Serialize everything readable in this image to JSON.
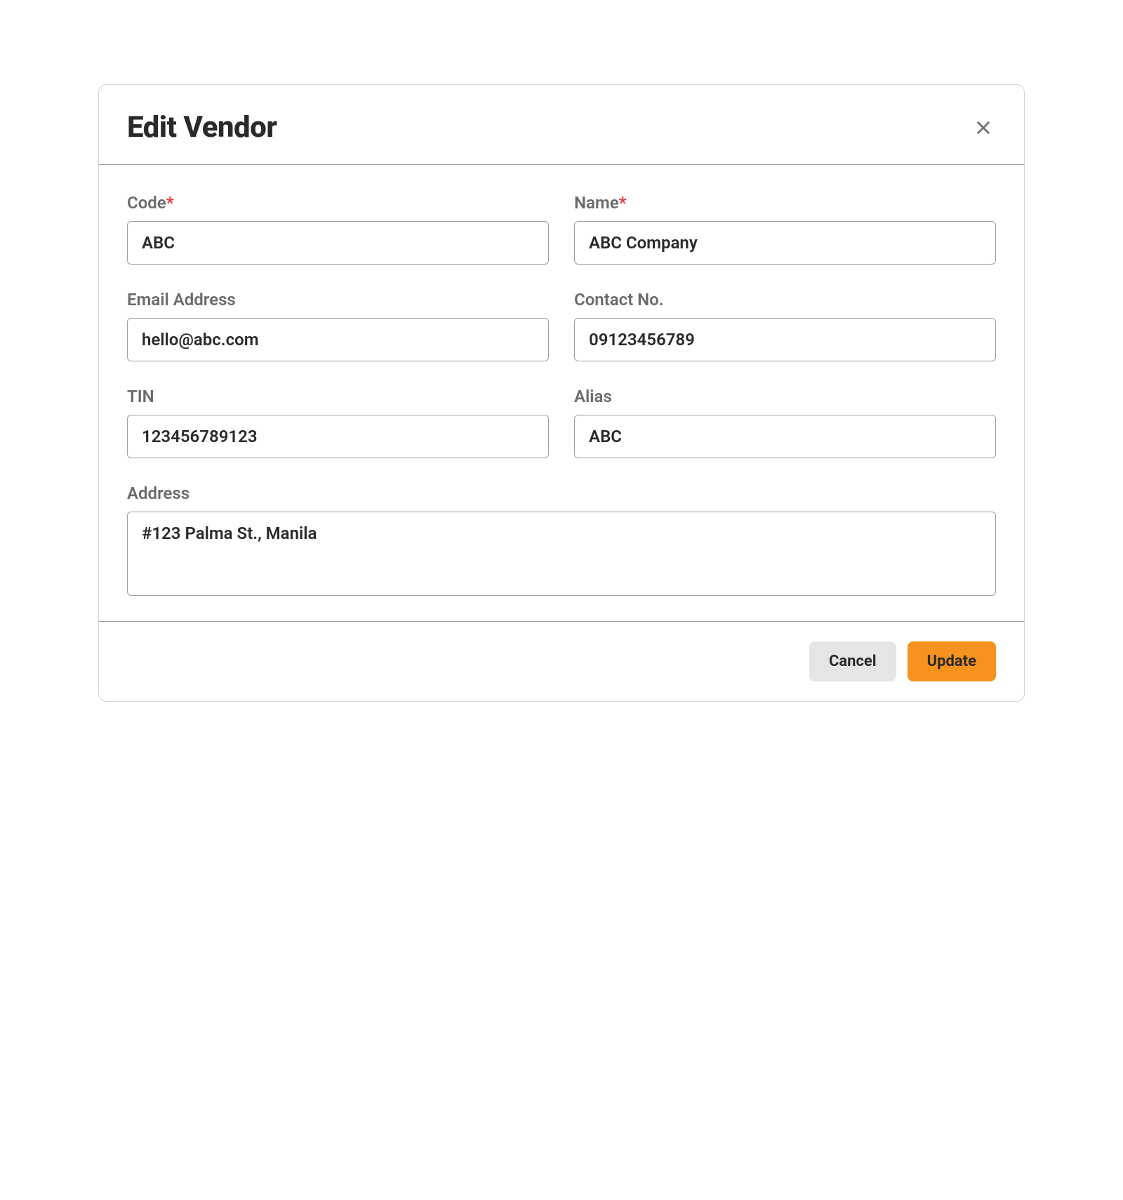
{
  "modal": {
    "title": "Edit Vendor"
  },
  "form": {
    "code": {
      "label": "Code",
      "value": "ABC",
      "required": true
    },
    "name": {
      "label": "Name",
      "value": "ABC Company",
      "required": true
    },
    "email": {
      "label": "Email Address",
      "value": "hello@abc.com",
      "required": false
    },
    "contact": {
      "label": "Contact No.",
      "value": "09123456789",
      "required": false
    },
    "tin": {
      "label": "TIN",
      "value": "123456789123",
      "required": false
    },
    "alias": {
      "label": "Alias",
      "value": "ABC",
      "required": false
    },
    "address": {
      "label": "Address",
      "value": "#123 Palma St., Manila",
      "required": false
    }
  },
  "required_marker": "*",
  "buttons": {
    "cancel": "Cancel",
    "update": "Update"
  }
}
